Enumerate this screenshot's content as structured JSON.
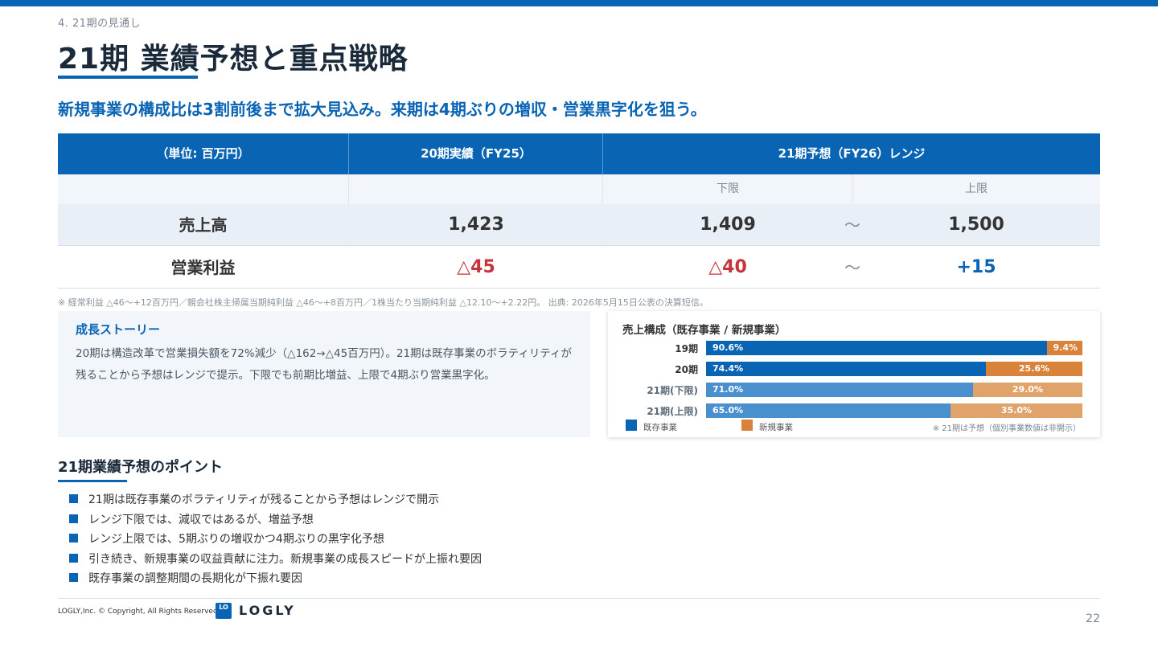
{
  "header": {
    "breadcrumb": "4. 21期の見通し",
    "title": "21期 業績予想と重点戦略",
    "lead": "新規事業の構成比は3割前後まで拡大見込み。来期は4期ぶりの増収・営業黒字化を狙う。"
  },
  "table": {
    "columns": [
      "（単位: 百万円）",
      "20期実績（FY25）",
      "21期予想（FY26）レンジ"
    ],
    "subcolumns": [
      "下限",
      "上限"
    ],
    "rows": [
      {
        "label": "売上高",
        "actual": "1,423",
        "lower": "1,409",
        "tilde": "～",
        "upper": "1,500"
      },
      {
        "label": "営業利益",
        "actual": "△45",
        "lower": "△40",
        "tilde": "～",
        "upper": "+15"
      }
    ],
    "note": "※ 経常利益 △46～+12百万円／親会社株主帰属当期純利益 △46～+8百万円／1株当たり当期純利益 △12.10～+2.22円。 出典: 2026年5月15日公表の決算短信。"
  },
  "story": {
    "title": "成長ストーリー",
    "body": "20期は構造改革で営業損失額を72%減少（△162→△45百万円）。21期は既存事業のボラティリティが残ることから予想はレンジで提示。下限でも前期比増益、上限で4期ぶり営業黒字化。"
  },
  "chart_data": {
    "type": "bar",
    "stacked": true,
    "orientation": "horizontal",
    "title": "売上構成（既存事業 / 新規事業）",
    "categories": [
      "19期",
      "20期",
      "21期(下限)",
      "21期(上限)"
    ],
    "series": [
      {
        "name": "既存事業",
        "values": [
          90.6,
          74.4,
          71.0,
          65.0
        ],
        "labels": [
          "90.6%",
          "74.4%",
          "71.0%",
          "65.0%"
        ]
      },
      {
        "name": "新規事業",
        "values": [
          9.4,
          25.6,
          29.0,
          35.0
        ],
        "labels": [
          "9.4%",
          "25.6%",
          "29.0%",
          "35.0%"
        ]
      }
    ],
    "legend": "bottom-left",
    "note": "※ 21期は予想（個別事業数値は非開示）"
  },
  "colors": {
    "brand": "#0a64b4",
    "existing_actual": "#0a64b4",
    "new_actual": "#d9823a",
    "existing_forecast": "#4a90cf",
    "new_forecast": "#e0a46b",
    "negative": "#c8323c"
  },
  "points": {
    "title": "21期業績予想のポイント",
    "items": [
      "21期は既存事業のボラティリティが残ることから予想はレンジで開示",
      "レンジ下限では、減収ではあるが、増益予想",
      "レンジ上限では、5期ぶりの増収かつ4期ぶりの黒字化予想",
      "引き続き、新規事業の収益貢献に注力。新規事業の成長スピードが上振れ要因",
      "既存事業の調整期間の長期化が下振れ要因"
    ]
  },
  "footer": {
    "copyright": "LOGLY,Inc. © Copyright, All Rights Reserved",
    "logo_mark": "LO",
    "logo_text": "LOGLY",
    "page_number": "22"
  }
}
